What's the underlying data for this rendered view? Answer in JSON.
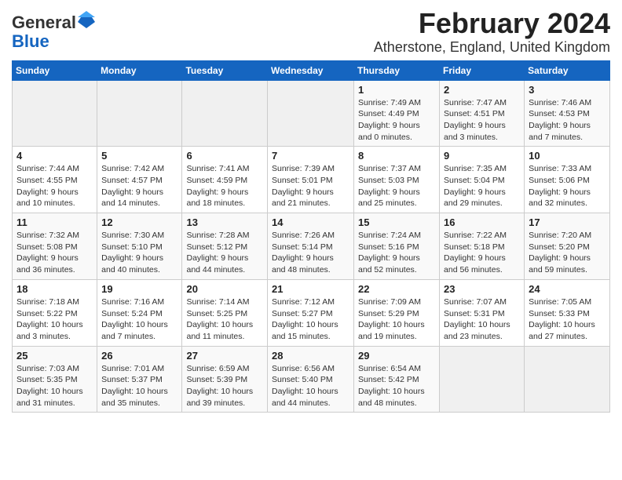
{
  "header": {
    "logo_general": "General",
    "logo_blue": "Blue",
    "title": "February 2024",
    "subtitle": "Atherstone, England, United Kingdom"
  },
  "columns": [
    "Sunday",
    "Monday",
    "Tuesday",
    "Wednesday",
    "Thursday",
    "Friday",
    "Saturday"
  ],
  "rows": [
    [
      {
        "day": "",
        "info": ""
      },
      {
        "day": "",
        "info": ""
      },
      {
        "day": "",
        "info": ""
      },
      {
        "day": "",
        "info": ""
      },
      {
        "day": "1",
        "info": "Sunrise: 7:49 AM\nSunset: 4:49 PM\nDaylight: 9 hours and 0 minutes."
      },
      {
        "day": "2",
        "info": "Sunrise: 7:47 AM\nSunset: 4:51 PM\nDaylight: 9 hours and 3 minutes."
      },
      {
        "day": "3",
        "info": "Sunrise: 7:46 AM\nSunset: 4:53 PM\nDaylight: 9 hours and 7 minutes."
      }
    ],
    [
      {
        "day": "4",
        "info": "Sunrise: 7:44 AM\nSunset: 4:55 PM\nDaylight: 9 hours and 10 minutes."
      },
      {
        "day": "5",
        "info": "Sunrise: 7:42 AM\nSunset: 4:57 PM\nDaylight: 9 hours and 14 minutes."
      },
      {
        "day": "6",
        "info": "Sunrise: 7:41 AM\nSunset: 4:59 PM\nDaylight: 9 hours and 18 minutes."
      },
      {
        "day": "7",
        "info": "Sunrise: 7:39 AM\nSunset: 5:01 PM\nDaylight: 9 hours and 21 minutes."
      },
      {
        "day": "8",
        "info": "Sunrise: 7:37 AM\nSunset: 5:03 PM\nDaylight: 9 hours and 25 minutes."
      },
      {
        "day": "9",
        "info": "Sunrise: 7:35 AM\nSunset: 5:04 PM\nDaylight: 9 hours and 29 minutes."
      },
      {
        "day": "10",
        "info": "Sunrise: 7:33 AM\nSunset: 5:06 PM\nDaylight: 9 hours and 32 minutes."
      }
    ],
    [
      {
        "day": "11",
        "info": "Sunrise: 7:32 AM\nSunset: 5:08 PM\nDaylight: 9 hours and 36 minutes."
      },
      {
        "day": "12",
        "info": "Sunrise: 7:30 AM\nSunset: 5:10 PM\nDaylight: 9 hours and 40 minutes."
      },
      {
        "day": "13",
        "info": "Sunrise: 7:28 AM\nSunset: 5:12 PM\nDaylight: 9 hours and 44 minutes."
      },
      {
        "day": "14",
        "info": "Sunrise: 7:26 AM\nSunset: 5:14 PM\nDaylight: 9 hours and 48 minutes."
      },
      {
        "day": "15",
        "info": "Sunrise: 7:24 AM\nSunset: 5:16 PM\nDaylight: 9 hours and 52 minutes."
      },
      {
        "day": "16",
        "info": "Sunrise: 7:22 AM\nSunset: 5:18 PM\nDaylight: 9 hours and 56 minutes."
      },
      {
        "day": "17",
        "info": "Sunrise: 7:20 AM\nSunset: 5:20 PM\nDaylight: 9 hours and 59 minutes."
      }
    ],
    [
      {
        "day": "18",
        "info": "Sunrise: 7:18 AM\nSunset: 5:22 PM\nDaylight: 10 hours and 3 minutes."
      },
      {
        "day": "19",
        "info": "Sunrise: 7:16 AM\nSunset: 5:24 PM\nDaylight: 10 hours and 7 minutes."
      },
      {
        "day": "20",
        "info": "Sunrise: 7:14 AM\nSunset: 5:25 PM\nDaylight: 10 hours and 11 minutes."
      },
      {
        "day": "21",
        "info": "Sunrise: 7:12 AM\nSunset: 5:27 PM\nDaylight: 10 hours and 15 minutes."
      },
      {
        "day": "22",
        "info": "Sunrise: 7:09 AM\nSunset: 5:29 PM\nDaylight: 10 hours and 19 minutes."
      },
      {
        "day": "23",
        "info": "Sunrise: 7:07 AM\nSunset: 5:31 PM\nDaylight: 10 hours and 23 minutes."
      },
      {
        "day": "24",
        "info": "Sunrise: 7:05 AM\nSunset: 5:33 PM\nDaylight: 10 hours and 27 minutes."
      }
    ],
    [
      {
        "day": "25",
        "info": "Sunrise: 7:03 AM\nSunset: 5:35 PM\nDaylight: 10 hours and 31 minutes."
      },
      {
        "day": "26",
        "info": "Sunrise: 7:01 AM\nSunset: 5:37 PM\nDaylight: 10 hours and 35 minutes."
      },
      {
        "day": "27",
        "info": "Sunrise: 6:59 AM\nSunset: 5:39 PM\nDaylight: 10 hours and 39 minutes."
      },
      {
        "day": "28",
        "info": "Sunrise: 6:56 AM\nSunset: 5:40 PM\nDaylight: 10 hours and 44 minutes."
      },
      {
        "day": "29",
        "info": "Sunrise: 6:54 AM\nSunset: 5:42 PM\nDaylight: 10 hours and 48 minutes."
      },
      {
        "day": "",
        "info": ""
      },
      {
        "day": "",
        "info": ""
      }
    ]
  ]
}
